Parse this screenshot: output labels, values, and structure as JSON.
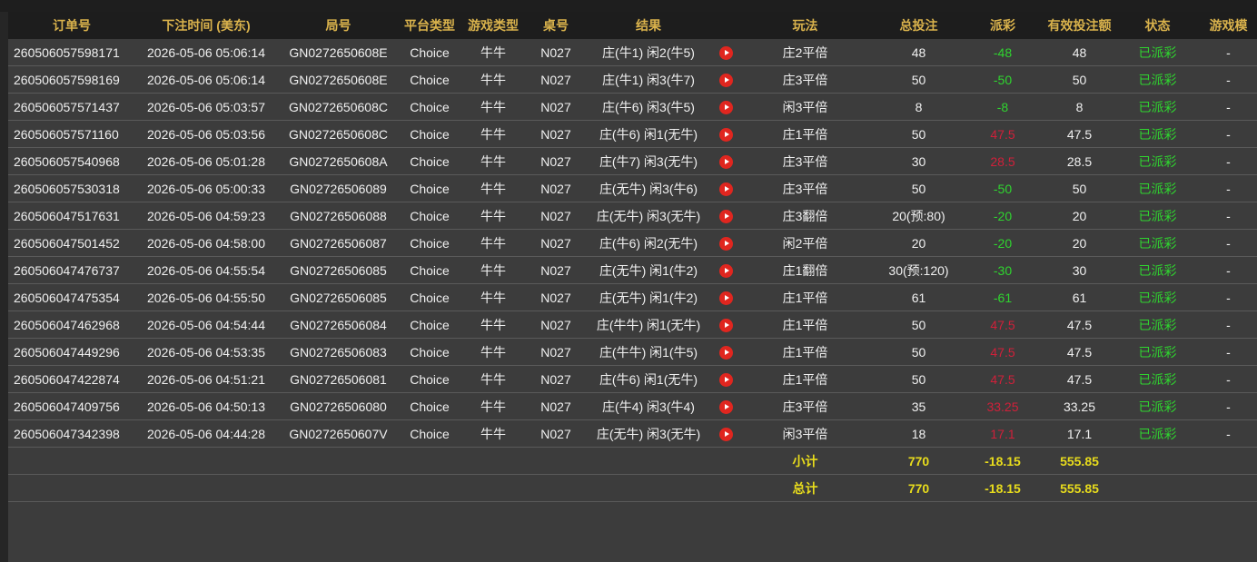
{
  "columns": [
    "订单号",
    "下注时间 (美东)",
    "局号",
    "平台类型",
    "游戏类型",
    "桌号",
    "结果",
    "",
    "玩法",
    "总投注",
    "派彩",
    "有效投注额",
    "状态",
    "游戏模"
  ],
  "play_icon": "play-circle-icon",
  "colors": {
    "header_text": "#d9b24c",
    "negative": "#2fd52f",
    "positive": "#d0203a",
    "status": "#2fd52f",
    "summary": "#e8dc1c",
    "play_icon": "#e0261f"
  },
  "rows": [
    {
      "order": "260506057598171",
      "time": "2026-05-06 05:06:14",
      "round": "GN0272650608E",
      "platform": "Choice",
      "game": "牛牛",
      "table": "N027",
      "result": "庄(牛1) 闲2(牛5)",
      "play": "庄2平倍",
      "bet": "48",
      "payout": "-48",
      "payout_sign": "neg",
      "valid": "48",
      "status": "已派彩",
      "mode": "-"
    },
    {
      "order": "260506057598169",
      "time": "2026-05-06 05:06:14",
      "round": "GN0272650608E",
      "platform": "Choice",
      "game": "牛牛",
      "table": "N027",
      "result": "庄(牛1) 闲3(牛7)",
      "play": "庄3平倍",
      "bet": "50",
      "payout": "-50",
      "payout_sign": "neg",
      "valid": "50",
      "status": "已派彩",
      "mode": "-"
    },
    {
      "order": "260506057571437",
      "time": "2026-05-06 05:03:57",
      "round": "GN0272650608C",
      "platform": "Choice",
      "game": "牛牛",
      "table": "N027",
      "result": "庄(牛6) 闲3(牛5)",
      "play": "闲3平倍",
      "bet": "8",
      "payout": "-8",
      "payout_sign": "neg",
      "valid": "8",
      "status": "已派彩",
      "mode": "-"
    },
    {
      "order": "260506057571160",
      "time": "2026-05-06 05:03:56",
      "round": "GN0272650608C",
      "platform": "Choice",
      "game": "牛牛",
      "table": "N027",
      "result": "庄(牛6) 闲1(无牛)",
      "play": "庄1平倍",
      "bet": "50",
      "payout": "47.5",
      "payout_sign": "pos",
      "valid": "47.5",
      "status": "已派彩",
      "mode": "-"
    },
    {
      "order": "260506057540968",
      "time": "2026-05-06 05:01:28",
      "round": "GN0272650608A",
      "platform": "Choice",
      "game": "牛牛",
      "table": "N027",
      "result": "庄(牛7) 闲3(无牛)",
      "play": "庄3平倍",
      "bet": "30",
      "payout": "28.5",
      "payout_sign": "pos",
      "valid": "28.5",
      "status": "已派彩",
      "mode": "-"
    },
    {
      "order": "260506057530318",
      "time": "2026-05-06 05:00:33",
      "round": "GN02726506089",
      "platform": "Choice",
      "game": "牛牛",
      "table": "N027",
      "result": "庄(无牛) 闲3(牛6)",
      "play": "庄3平倍",
      "bet": "50",
      "payout": "-50",
      "payout_sign": "neg",
      "valid": "50",
      "status": "已派彩",
      "mode": "-"
    },
    {
      "order": "260506047517631",
      "time": "2026-05-06 04:59:23",
      "round": "GN02726506088",
      "platform": "Choice",
      "game": "牛牛",
      "table": "N027",
      "result": "庄(无牛) 闲3(无牛)",
      "play": "庄3翻倍",
      "bet": "20(预:80)",
      "payout": "-20",
      "payout_sign": "neg",
      "valid": "20",
      "status": "已派彩",
      "mode": "-"
    },
    {
      "order": "260506047501452",
      "time": "2026-05-06 04:58:00",
      "round": "GN02726506087",
      "platform": "Choice",
      "game": "牛牛",
      "table": "N027",
      "result": "庄(牛6) 闲2(无牛)",
      "play": "闲2平倍",
      "bet": "20",
      "payout": "-20",
      "payout_sign": "neg",
      "valid": "20",
      "status": "已派彩",
      "mode": "-"
    },
    {
      "order": "260506047476737",
      "time": "2026-05-06 04:55:54",
      "round": "GN02726506085",
      "platform": "Choice",
      "game": "牛牛",
      "table": "N027",
      "result": "庄(无牛) 闲1(牛2)",
      "play": "庄1翻倍",
      "bet": "30(预:120)",
      "payout": "-30",
      "payout_sign": "neg",
      "valid": "30",
      "status": "已派彩",
      "mode": "-"
    },
    {
      "order": "260506047475354",
      "time": "2026-05-06 04:55:50",
      "round": "GN02726506085",
      "platform": "Choice",
      "game": "牛牛",
      "table": "N027",
      "result": "庄(无牛) 闲1(牛2)",
      "play": "庄1平倍",
      "bet": "61",
      "payout": "-61",
      "payout_sign": "neg",
      "valid": "61",
      "status": "已派彩",
      "mode": "-"
    },
    {
      "order": "260506047462968",
      "time": "2026-05-06 04:54:44",
      "round": "GN02726506084",
      "platform": "Choice",
      "game": "牛牛",
      "table": "N027",
      "result": "庄(牛牛) 闲1(无牛)",
      "play": "庄1平倍",
      "bet": "50",
      "payout": "47.5",
      "payout_sign": "pos",
      "valid": "47.5",
      "status": "已派彩",
      "mode": "-"
    },
    {
      "order": "260506047449296",
      "time": "2026-05-06 04:53:35",
      "round": "GN02726506083",
      "platform": "Choice",
      "game": "牛牛",
      "table": "N027",
      "result": "庄(牛牛) 闲1(牛5)",
      "play": "庄1平倍",
      "bet": "50",
      "payout": "47.5",
      "payout_sign": "pos",
      "valid": "47.5",
      "status": "已派彩",
      "mode": "-"
    },
    {
      "order": "260506047422874",
      "time": "2026-05-06 04:51:21",
      "round": "GN02726506081",
      "platform": "Choice",
      "game": "牛牛",
      "table": "N027",
      "result": "庄(牛6) 闲1(无牛)",
      "play": "庄1平倍",
      "bet": "50",
      "payout": "47.5",
      "payout_sign": "pos",
      "valid": "47.5",
      "status": "已派彩",
      "mode": "-"
    },
    {
      "order": "260506047409756",
      "time": "2026-05-06 04:50:13",
      "round": "GN02726506080",
      "platform": "Choice",
      "game": "牛牛",
      "table": "N027",
      "result": "庄(牛4) 闲3(牛4)",
      "play": "庄3平倍",
      "bet": "35",
      "payout": "33.25",
      "payout_sign": "pos",
      "valid": "33.25",
      "status": "已派彩",
      "mode": "-"
    },
    {
      "order": "260506047342398",
      "time": "2026-05-06 04:44:28",
      "round": "GN0272650607V",
      "platform": "Choice",
      "game": "牛牛",
      "table": "N027",
      "result": "庄(无牛) 闲3(无牛)",
      "play": "闲3平倍",
      "bet": "18",
      "payout": "17.1",
      "payout_sign": "pos",
      "valid": "17.1",
      "status": "已派彩",
      "mode": "-"
    }
  ],
  "subtotal": {
    "label": "小计",
    "bet": "770",
    "payout": "-18.15",
    "valid": "555.85"
  },
  "total": {
    "label": "总计",
    "bet": "770",
    "payout": "-18.15",
    "valid": "555.85"
  }
}
